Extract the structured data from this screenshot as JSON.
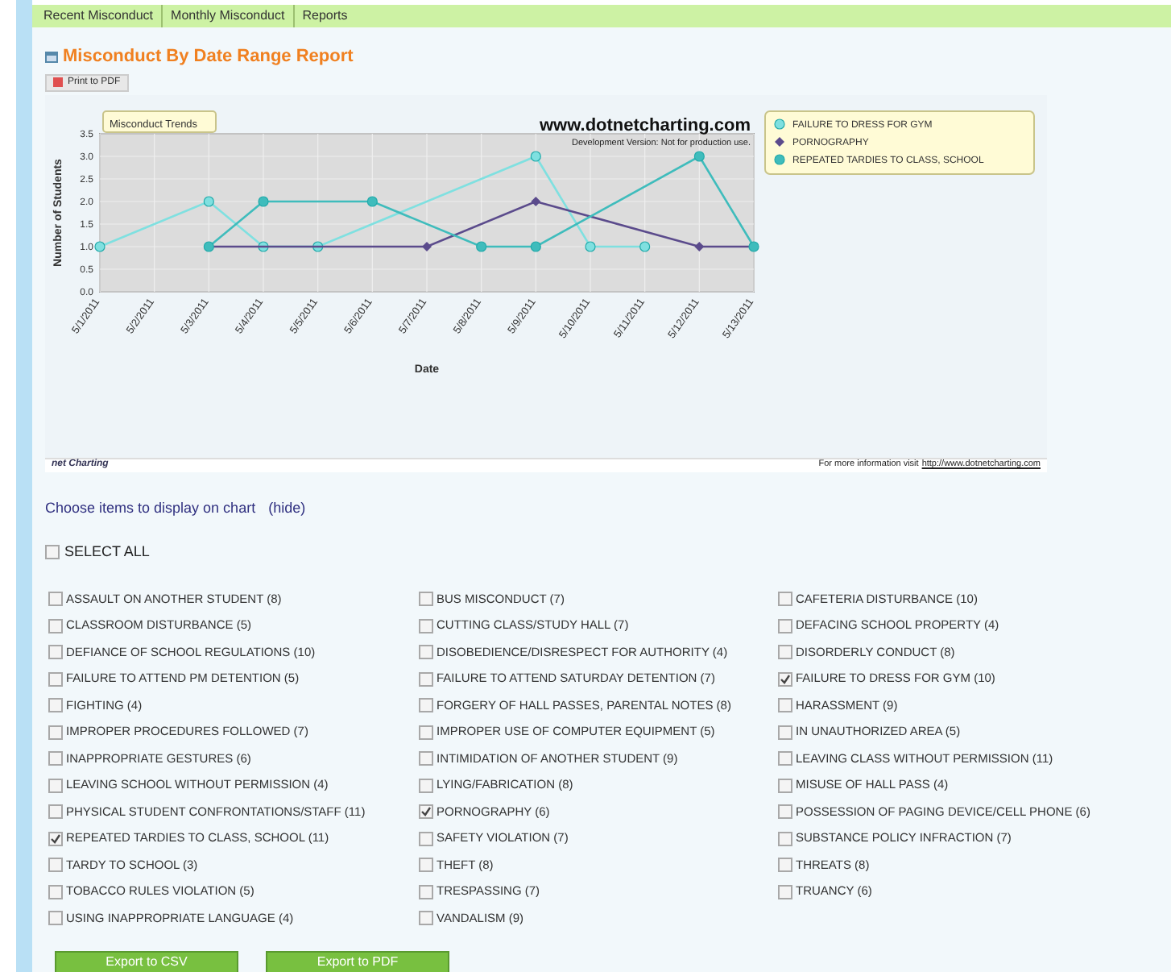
{
  "tabs": [
    {
      "label": "Recent Misconduct"
    },
    {
      "label": "Monthly Misconduct"
    },
    {
      "label": "Reports"
    }
  ],
  "report_title": "Misconduct By Date Range Report",
  "print_button": "Print to PDF",
  "chart": {
    "tab_label": "Misconduct Trends",
    "watermark": "www.dotnetcharting.com",
    "watermark_note": "Development Version: Not for production use.",
    "footer_logo": "net Charting",
    "footer_text": "For more information visit",
    "footer_link": "http://www.dotnetcharting.com",
    "chart_data": {
      "type": "line",
      "grid": true,
      "legend": true,
      "xlabel": "Date",
      "ylabel": "Number of Students",
      "categories": [
        "5/1/2011",
        "5/2/2011",
        "5/3/2011",
        "5/4/2011",
        "5/5/2011",
        "5/6/2011",
        "5/7/2011",
        "5/8/2011",
        "5/9/2011",
        "5/10/2011",
        "5/11/2011",
        "5/12/2011",
        "5/13/2011"
      ],
      "ylim": [
        0,
        3.5
      ],
      "yticks": [
        {
          "value": 0,
          "label": "0.0"
        },
        {
          "value": 0.5,
          "label": "0.5"
        },
        {
          "value": 1,
          "label": "1.0"
        },
        {
          "value": 1.5,
          "label": "1.5"
        },
        {
          "value": 2,
          "label": "2.0"
        },
        {
          "value": 2.5,
          "label": "2.5"
        },
        {
          "value": 3,
          "label": "3.0"
        },
        {
          "value": 3.5,
          "label": "3.5"
        }
      ],
      "series": [
        {
          "name": "FAILURE TO DRESS FOR GYM",
          "color": "#7fe0e0",
          "marker": "circle",
          "values": [
            1,
            null,
            2,
            1,
            1,
            null,
            null,
            null,
            3,
            1,
            1,
            null,
            null
          ]
        },
        {
          "name": "PORNOGRAPHY",
          "color": "#5b4b8c",
          "marker": "diamond",
          "values": [
            null,
            null,
            1,
            null,
            null,
            null,
            1,
            null,
            2,
            null,
            null,
            1,
            1
          ]
        },
        {
          "name": "REPEATED TARDIES TO CLASS, SCHOOL",
          "color": "#3fbcbc",
          "marker": "circle",
          "values": [
            null,
            null,
            1,
            2,
            null,
            2,
            null,
            1,
            1,
            null,
            null,
            3,
            1
          ]
        }
      ]
    }
  },
  "choose_label": "Choose items to display on chart",
  "hide_link": "(hide)",
  "select_all": {
    "label": "SELECT ALL",
    "checked": false
  },
  "items": [
    {
      "label": "ASSAULT ON ANOTHER STUDENT (8)",
      "checked": false
    },
    {
      "label": "BUS MISCONDUCT (7)",
      "checked": false
    },
    {
      "label": "CAFETERIA DISTURBANCE (10)",
      "checked": false
    },
    {
      "label": "CLASSROOM DISTURBANCE (5)",
      "checked": false
    },
    {
      "label": "CUTTING CLASS/STUDY HALL (7)",
      "checked": false
    },
    {
      "label": "DEFACING SCHOOL PROPERTY (4)",
      "checked": false
    },
    {
      "label": "DEFIANCE OF SCHOOL REGULATIONS (10)",
      "checked": false
    },
    {
      "label": "DISOBEDIENCE/DISRESPECT FOR AUTHORITY (4)",
      "checked": false
    },
    {
      "label": "DISORDERLY CONDUCT (8)",
      "checked": false
    },
    {
      "label": "FAILURE TO ATTEND PM DETENTION (5)",
      "checked": false
    },
    {
      "label": "FAILURE TO ATTEND SATURDAY DETENTION (7)",
      "checked": false
    },
    {
      "label": "FAILURE TO DRESS FOR GYM (10)",
      "checked": true
    },
    {
      "label": "FIGHTING (4)",
      "checked": false
    },
    {
      "label": "FORGERY OF HALL PASSES, PARENTAL NOTES (8)",
      "checked": false
    },
    {
      "label": "HARASSMENT (9)",
      "checked": false
    },
    {
      "label": "IMPROPER PROCEDURES FOLLOWED (7)",
      "checked": false
    },
    {
      "label": "IMPROPER USE OF COMPUTER EQUIPMENT (5)",
      "checked": false
    },
    {
      "label": "IN UNAUTHORIZED AREA (5)",
      "checked": false
    },
    {
      "label": "INAPPROPRIATE GESTURES (6)",
      "checked": false
    },
    {
      "label": "INTIMIDATION OF ANOTHER STUDENT (9)",
      "checked": false
    },
    {
      "label": "LEAVING CLASS WITHOUT PERMISSION (11)",
      "checked": false
    },
    {
      "label": "LEAVING SCHOOL WITHOUT PERMISSION (4)",
      "checked": false
    },
    {
      "label": "LYING/FABRICATION (8)",
      "checked": false
    },
    {
      "label": "MISUSE OF HALL PASS (4)",
      "checked": false
    },
    {
      "label": "PHYSICAL STUDENT CONFRONTATIONS/STAFF (11)",
      "checked": false
    },
    {
      "label": "PORNOGRAPHY (6)",
      "checked": true
    },
    {
      "label": "POSSESSION OF PAGING DEVICE/CELL PHONE (6)",
      "checked": false
    },
    {
      "label": "REPEATED TARDIES TO CLASS, SCHOOL (11)",
      "checked": true
    },
    {
      "label": "SAFETY VIOLATION (7)",
      "checked": false
    },
    {
      "label": "SUBSTANCE POLICY INFRACTION (7)",
      "checked": false
    },
    {
      "label": "TARDY TO SCHOOL (3)",
      "checked": false
    },
    {
      "label": "THEFT (8)",
      "checked": false
    },
    {
      "label": "THREATS (8)",
      "checked": false
    },
    {
      "label": "TOBACCO RULES VIOLATION (5)",
      "checked": false
    },
    {
      "label": "TRESPASSING (7)",
      "checked": false
    },
    {
      "label": "TRUANCY (6)",
      "checked": false
    },
    {
      "label": "USING INAPPROPRIATE LANGUAGE (4)",
      "checked": false
    },
    {
      "label": "VANDALISM (9)",
      "checked": false
    }
  ],
  "buttons": [
    "Export to CSV",
    "Export to PDF"
  ]
}
